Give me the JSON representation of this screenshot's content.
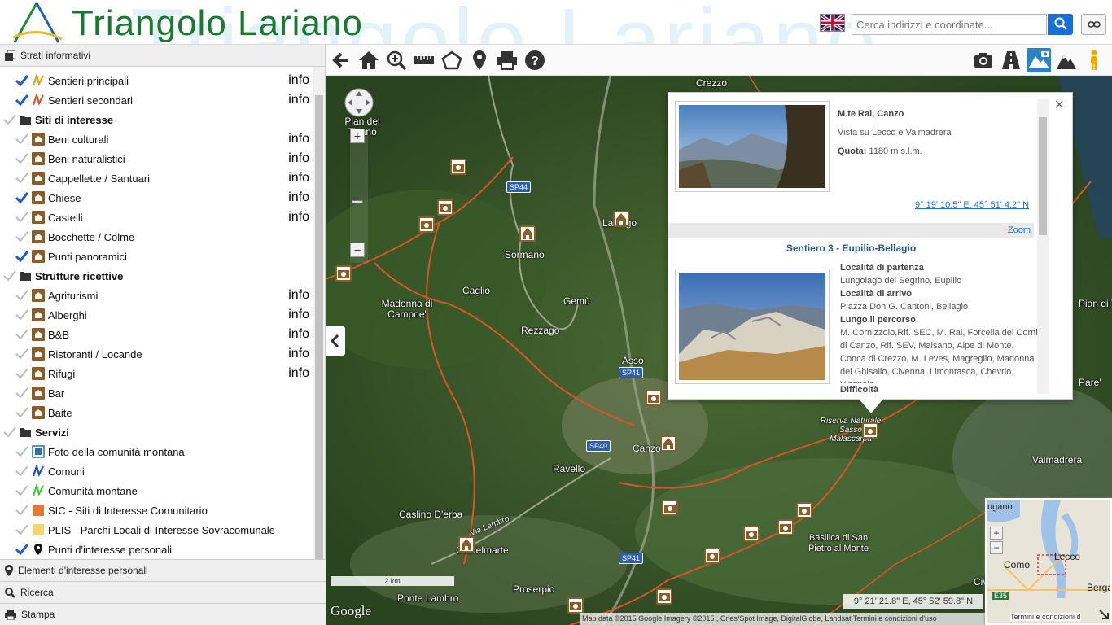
{
  "header": {
    "bg_word": "Triangolo Lariano",
    "logo_text": "Triangolo Lariano",
    "search_placeholder": "Cerca indirizzi e coordinate..."
  },
  "sidebar": {
    "title": "Strati informativi",
    "info_label": "info",
    "layers": [
      {
        "label": "Sentieri principali",
        "checked": true,
        "info": true,
        "group": false,
        "icon": "trail-main-icon"
      },
      {
        "label": "Sentieri secondari",
        "checked": true,
        "info": true,
        "group": false,
        "icon": "trail-secondary-icon"
      },
      {
        "label": "Siti di interesse",
        "checked": false,
        "info": false,
        "group": true,
        "icon": "folder-open-icon"
      },
      {
        "label": "Beni culturali",
        "checked": false,
        "info": true,
        "group": false,
        "icon": "museum-icon"
      },
      {
        "label": "Beni naturalistici",
        "checked": false,
        "info": true,
        "group": false,
        "icon": "nature-icon"
      },
      {
        "label": "Cappellette / Santuari",
        "checked": false,
        "info": true,
        "group": false,
        "icon": "chapel-icon"
      },
      {
        "label": "Chiese",
        "checked": true,
        "info": true,
        "group": false,
        "icon": "church-icon"
      },
      {
        "label": "Castelli",
        "checked": false,
        "info": true,
        "group": false,
        "icon": "castle-icon"
      },
      {
        "label": "Bocchette / Colme",
        "checked": false,
        "info": false,
        "group": false,
        "icon": "pass-icon"
      },
      {
        "label": "Punti panoramici",
        "checked": true,
        "info": false,
        "group": false,
        "icon": "camera-icon"
      },
      {
        "label": "Strutture ricettive",
        "checked": false,
        "info": false,
        "group": true,
        "icon": "folder-open-icon"
      },
      {
        "label": "Agriturismi",
        "checked": false,
        "info": true,
        "group": false,
        "icon": "farm-icon"
      },
      {
        "label": "Alberghi",
        "checked": false,
        "info": true,
        "group": false,
        "icon": "hotel-icon"
      },
      {
        "label": "B&B",
        "checked": false,
        "info": true,
        "group": false,
        "icon": "bnb-icon"
      },
      {
        "label": "Ristoranti / Locande",
        "checked": false,
        "info": true,
        "group": false,
        "icon": "restaurant-icon"
      },
      {
        "label": "Rifugi",
        "checked": false,
        "info": true,
        "group": false,
        "icon": "hut-icon"
      },
      {
        "label": "Bar",
        "checked": false,
        "info": false,
        "group": false,
        "icon": "bar-icon"
      },
      {
        "label": "Baite",
        "checked": false,
        "info": false,
        "group": false,
        "icon": "cabin-icon"
      },
      {
        "label": "Servizi",
        "checked": false,
        "info": false,
        "group": true,
        "icon": "folder-icon"
      },
      {
        "label": "Foto della comunità montana",
        "checked": false,
        "info": false,
        "group": false,
        "icon": "photo-icon"
      },
      {
        "label": "Comuni",
        "checked": false,
        "info": false,
        "group": false,
        "icon": "municipality-icon"
      },
      {
        "label": "Comunità montane",
        "checked": false,
        "info": false,
        "group": false,
        "icon": "mountain-community-icon"
      },
      {
        "label": "SIC - Siti di Interesse Comunitario",
        "checked": false,
        "info": false,
        "group": false,
        "icon": "sic-icon"
      },
      {
        "label": "PLIS - Parchi Locali di Interesse Sovracomunale",
        "checked": false,
        "info": false,
        "group": false,
        "icon": "plis-icon"
      },
      {
        "label": "Punti d'interesse personali",
        "checked": true,
        "info": false,
        "group": false,
        "icon": "pin-icon"
      }
    ],
    "footer": [
      "Elementi d'interesse personali",
      "Ricerca",
      "Stampa"
    ]
  },
  "map": {
    "labels": [
      "Crezzo",
      "Pian del Tivano",
      "Sormano",
      "Lasnigo",
      "Caglio",
      "Madonna di Campoe'",
      "Rezzago",
      "Gemù",
      "Asso",
      "Canzo",
      "Ravello",
      "Caslino D'erba",
      "Via Lambro",
      "Castelmarte",
      "Proserpio",
      "Ponte Lambro",
      "Basilica di San Pietro al Monte",
      "Riserva Naturale Sasso Malascarpa",
      "Valmadrera",
      "Pare'",
      "Pian di Tivano",
      "Civate"
    ],
    "roads": [
      "SP44",
      "SP41",
      "SP40",
      "SP41"
    ],
    "scale": "2 km",
    "coords": "9° 21' 21.8\" E, 45° 52' 59.8\" N",
    "attribution": "Map data ©2015 Google Imagery ©2015 , Cnes/Spot Image, DigitalGlobe, Landsat   Termini e condizioni d'uso",
    "google": "Google",
    "overview": {
      "como": "Como",
      "lecco": "Lecco",
      "berga": "Berga",
      "lugano": "ugano",
      "e35": "E35",
      "termini": "Termini e condizioni d"
    }
  },
  "popup": {
    "item1": {
      "title": "M.te Rai, Canzo",
      "desc": "Vista su Lecco e Valmadrera",
      "quota_label": "Quota:",
      "quota": "1180 m s.l.m.",
      "coord_link": "9° 19' 10.5\" E, 45° 51' 4.2\" N"
    },
    "zoom": "Zoom",
    "item2": {
      "title": "Sentiero 3 - Eupilio-Bellagio",
      "partenza_label": "Località di partenza",
      "partenza": "Lungolago del Segrino, Eupilio",
      "arrivo_label": "Località di arrivo",
      "arrivo": "Piazza Don G. Cantoni, Bellagio",
      "percorso_label": "Lungo il percorso",
      "percorso": [
        "M. Cornizzolo,Rif. SEC, M. Rai, Forcella dei Corni",
        "di Canzo, Rif. SEV, Maisano, Alpe di Monte,",
        "Conca di Crezzo, M. Leves, Magreglio, Madonna",
        "del Ghisallo, Civenna, Limontasca, Chevrio,",
        "Visgnola"
      ],
      "difficolta_label": "Difficoltà"
    }
  },
  "colors": {
    "accent": "#1a6fd6",
    "brand_green": "#177a2e",
    "marker": "#8a5c26",
    "trail": "#d9542c"
  }
}
